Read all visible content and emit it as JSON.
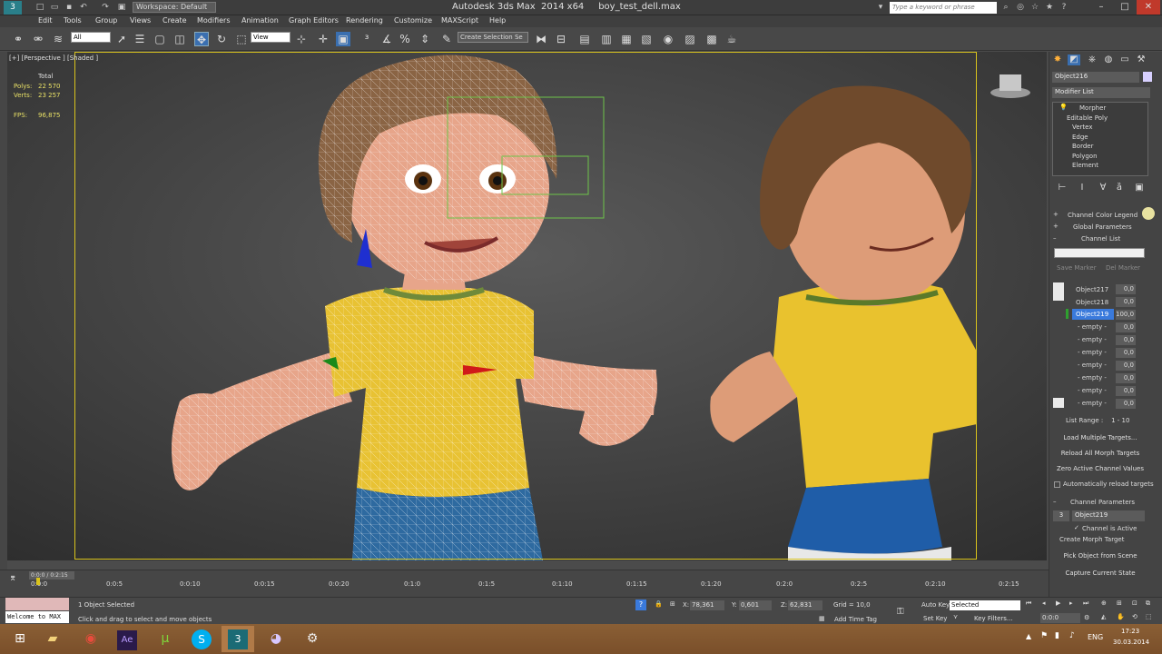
{
  "titlebar": {
    "workspace": "Workspace: Default",
    "title": "Autodesk 3ds Max  2014 x64     boy_test_dell.max",
    "search_placeholder": "Type a keyword or phrase"
  },
  "menu": [
    "Edit",
    "Tools",
    "Group",
    "Views",
    "Create",
    "Modifiers",
    "Animation",
    "Graph Editors",
    "Rendering",
    "Customize",
    "MAXScript",
    "Help"
  ],
  "toolbar": {
    "filter": "All",
    "coord": "View",
    "selection_set": "Create Selection Se"
  },
  "viewport": {
    "label": "[+] [Perspective ] [Shaded ]",
    "stats_header": "Total",
    "polys_label": "Polys:",
    "polys_value": "22 570",
    "verts_label": "Verts:",
    "verts_value": "23 257",
    "fps_label": "FPS:",
    "fps_value": "96,875"
  },
  "command_panel": {
    "object_name": "Object216",
    "modifier_list": "Modifier List",
    "stack": [
      "Morpher",
      "Editable Poly",
      "Vertex",
      "Edge",
      "Border",
      "Polygon",
      "Element"
    ],
    "rollouts": {
      "channel_color_legend": "Channel Color Legend",
      "global_parameters": "Global Parameters",
      "channel_list": "Channel List",
      "save_marker": "Save Marker",
      "del_marker": "Del Marker",
      "list_range": "List Range :    1 - 10",
      "load_multiple": "Load Multiple Targets...",
      "reload_all": "Reload All Morph Targets",
      "zero_active": "Zero Active Channel Values",
      "auto_reload": "Automatically reload targets",
      "channel_parameters": "Channel Parameters",
      "channel_number": "3",
      "channel_name": "Object219",
      "channel_active": "Channel is Active",
      "create_morph_target": "Create Morph Target",
      "pick_object": "Pick Object from Scene",
      "capture_state": "Capture Current State"
    },
    "channels": [
      {
        "name": "Object217",
        "value": "0,0"
      },
      {
        "name": "Object218",
        "value": "0,0"
      },
      {
        "name": "Object219",
        "value": "100,0"
      },
      {
        "name": "- empty -",
        "value": "0,0"
      },
      {
        "name": "- empty -",
        "value": "0,0"
      },
      {
        "name": "- empty -",
        "value": "0,0"
      },
      {
        "name": "- empty -",
        "value": "0,0"
      },
      {
        "name": "- empty -",
        "value": "0,0"
      },
      {
        "name": "- empty -",
        "value": "0,0"
      },
      {
        "name": "- empty -",
        "value": "0,0"
      }
    ]
  },
  "timeline": {
    "frame_label": "0:0:0 / 0:2:15",
    "ticks": [
      "0:0:0",
      "0:0:5",
      "0:0:10",
      "0:0:15",
      "0:0:20",
      "0:1:0",
      "0:1:5",
      "0:1:10",
      "0:1:15",
      "0:1:20",
      "0:2:0",
      "0:2:5",
      "0:2:10",
      "0:2:15"
    ]
  },
  "statusbar": {
    "maxscript": "Welcome to MAX",
    "selected": "1 Object Selected",
    "prompt": "Click and drag to select and move objects",
    "x_label": "X:",
    "x_value": "78,361",
    "y_label": "Y:",
    "y_value": "0,601",
    "z_label": "Z:",
    "z_value": "62,831",
    "grid": "Grid = 10,0",
    "add_time_tag": "Add Time Tag",
    "auto_key": "Auto Key",
    "set_key": "Set Key",
    "key_mode": "Selected",
    "key_filters": "Key Filters...",
    "current_frame": "0:0:0"
  },
  "taskbar": {
    "lang": "ENG",
    "time": "17:23",
    "date": "30.03.2014"
  }
}
